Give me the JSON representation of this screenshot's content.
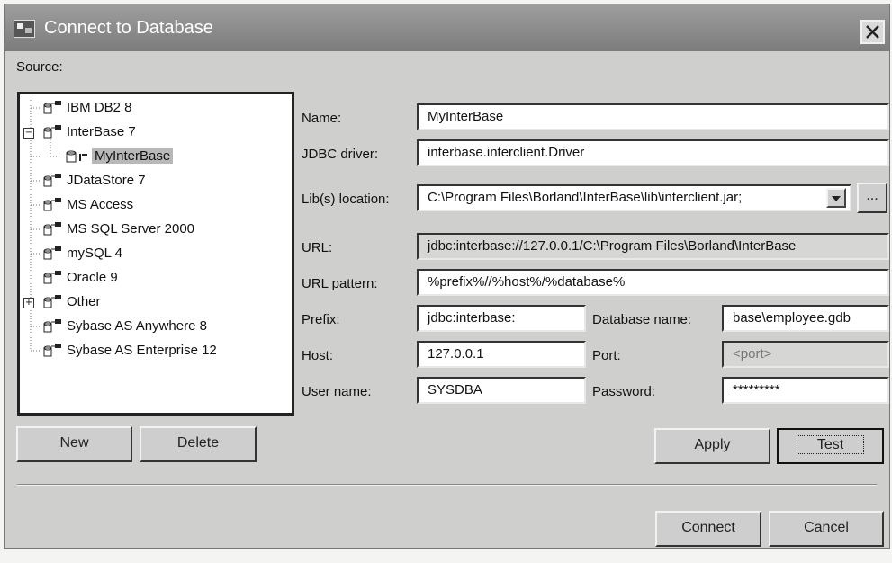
{
  "window": {
    "title": "Connect to Database"
  },
  "source_label": "Source:",
  "tree": {
    "items": [
      {
        "label": "IBM DB2 8"
      },
      {
        "label": "InterBase 7",
        "expander": "−"
      },
      {
        "label": "MyInterBase"
      },
      {
        "label": "JDataStore 7"
      },
      {
        "label": "MS Access"
      },
      {
        "label": "MS SQL Server 2000"
      },
      {
        "label": "mySQL 4"
      },
      {
        "label": "Oracle 9"
      },
      {
        "label": "Other",
        "expander": "+"
      },
      {
        "label": "Sybase AS Anywhere 8"
      },
      {
        "label": "Sybase AS Enterprise 12"
      }
    ]
  },
  "form": {
    "name_label": "Name:",
    "name_value": "MyInterBase",
    "driver_label": "JDBC driver:",
    "driver_value": "interbase.interclient.Driver",
    "lib_label": "Lib(s) location:",
    "lib_value": "C:\\Program Files\\Borland\\InterBase\\lib\\interclient.jar;",
    "browse_label": "...",
    "url_label": "URL:",
    "url_value": "jdbc:interbase://127.0.0.1/C:\\Program Files\\Borland\\InterBase",
    "url_pattern_label": "URL pattern:",
    "url_pattern_value": "%prefix%//%host%/%database%",
    "prefix_label": "Prefix:",
    "prefix_value": "jdbc:interbase:",
    "dbname_label": "Database name:",
    "dbname_value": "base\\employee.gdb",
    "host_label": "Host:",
    "host_value": "127.0.0.1",
    "port_label": "Port:",
    "port_placeholder": "<port>",
    "user_label": "User name:",
    "user_value": "SYSDBA",
    "password_label": "Password:",
    "password_value": "*********"
  },
  "buttons": {
    "new": "New",
    "delete": "Delete",
    "apply": "Apply",
    "test": "Test",
    "connect": "Connect",
    "cancel": "Cancel"
  }
}
